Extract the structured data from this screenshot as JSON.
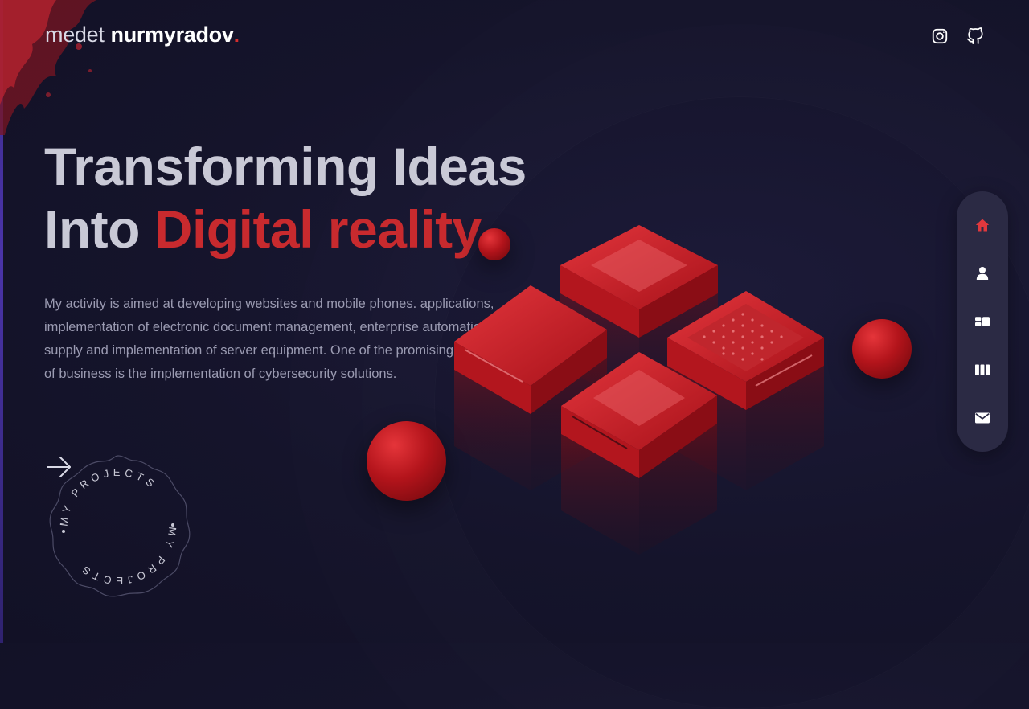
{
  "logo": {
    "first": "medet",
    "last": "nurmyradov",
    "dot": "."
  },
  "header": {
    "social": [
      {
        "icon": "instagram-icon"
      },
      {
        "icon": "github-icon"
      }
    ]
  },
  "hero": {
    "title_line1": "Transforming Ideas",
    "title_line2_plain": "Into",
    "title_line2_accent": "Digital reality",
    "description": "My activity is aimed at developing websites and mobile phones. applications, implementation of electronic document management, enterprise automation, supply and implementation of server equipment. One of the promising areas of business is the implementation of cybersecurity solutions."
  },
  "badge": {
    "label": "MY PROJECTS",
    "icon": "arrow-right-icon"
  },
  "sidenav": {
    "active_index": 0,
    "items": [
      {
        "icon": "home-icon"
      },
      {
        "icon": "user-icon"
      },
      {
        "icon": "services-icon"
      },
      {
        "icon": "portfolio-icon"
      },
      {
        "icon": "mail-icon"
      }
    ]
  },
  "colors": {
    "accent": "#c82a2e",
    "background": "#15142b",
    "nav_bg": "#2b2a44",
    "text_muted": "#9b9bb2"
  }
}
